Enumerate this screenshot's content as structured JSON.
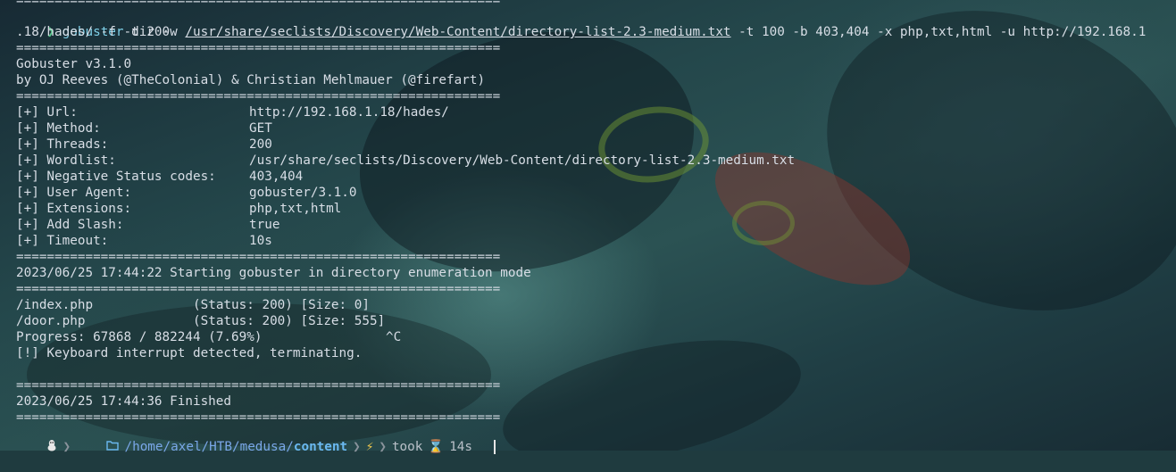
{
  "command": {
    "prompt_symbol": "❯",
    "program": "gobuster",
    "args_before_path": " dir -w ",
    "wordlist_path": "/usr/share/seclists/Discovery/Web-Content/directory-list-2.3-medium.txt",
    "args_after_path": " -t 100 -b 403,404 -x php,txt,html -u http://192.168.1",
    "continuation": ".18/hades/ -f -t 200"
  },
  "separator": "===============================================================",
  "banner": {
    "version": "Gobuster v3.1.0",
    "authors": "by OJ Reeves (@TheColonial) & Christian Mehlmauer (@firefart)"
  },
  "config": [
    {
      "label": "[+] Url:",
      "value": "http://192.168.1.18/hades/"
    },
    {
      "label": "[+] Method:",
      "value": "GET"
    },
    {
      "label": "[+] Threads:",
      "value": "200"
    },
    {
      "label": "[+] Wordlist:",
      "value": "/usr/share/seclists/Discovery/Web-Content/directory-list-2.3-medium.txt"
    },
    {
      "label": "[+] Negative Status codes:",
      "value": "403,404"
    },
    {
      "label": "[+] User Agent:",
      "value": "gobuster/3.1.0"
    },
    {
      "label": "[+] Extensions:",
      "value": "php,txt,html"
    },
    {
      "label": "[+] Add Slash:",
      "value": "true"
    },
    {
      "label": "[+] Timeout:",
      "value": "10s"
    }
  ],
  "start_message": "2023/06/25 17:44:22 Starting gobuster in directory enumeration mode",
  "results": [
    {
      "path": "/index.php",
      "status": "(Status: 200) [Size: 0]"
    },
    {
      "path": "/door.php",
      "status": "(Status: 200) [Size: 555]"
    }
  ],
  "progress": {
    "text": "Progress: 67868 / 882244 (7.69%)",
    "interrupt": "^C"
  },
  "interrupt_message": "[!] Keyboard interrupt detected, terminating.",
  "finished_message": "2023/06/25 17:44:36 Finished",
  "statusbar": {
    "os_icon": "linux-icon",
    "folder_icon": "folder-icon",
    "path_home": "/home/axel/HTB/medusa/",
    "path_current": "content",
    "bolt_icon": "lightning-icon",
    "took_label": "took",
    "hourglass_icon": "hourglass-icon",
    "took_value": "14s"
  }
}
